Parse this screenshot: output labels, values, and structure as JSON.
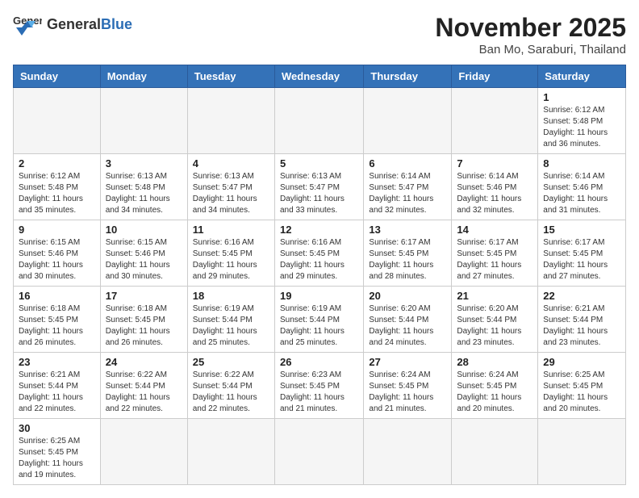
{
  "header": {
    "logo_general": "General",
    "logo_blue": "Blue",
    "month_title": "November 2025",
    "location": "Ban Mo, Saraburi, Thailand"
  },
  "weekdays": [
    "Sunday",
    "Monday",
    "Tuesday",
    "Wednesday",
    "Thursday",
    "Friday",
    "Saturday"
  ],
  "weeks": [
    [
      {
        "day": "",
        "info": ""
      },
      {
        "day": "",
        "info": ""
      },
      {
        "day": "",
        "info": ""
      },
      {
        "day": "",
        "info": ""
      },
      {
        "day": "",
        "info": ""
      },
      {
        "day": "",
        "info": ""
      },
      {
        "day": "1",
        "info": "Sunrise: 6:12 AM\nSunset: 5:48 PM\nDaylight: 11 hours\nand 36 minutes."
      }
    ],
    [
      {
        "day": "2",
        "info": "Sunrise: 6:12 AM\nSunset: 5:48 PM\nDaylight: 11 hours\nand 35 minutes."
      },
      {
        "day": "3",
        "info": "Sunrise: 6:13 AM\nSunset: 5:48 PM\nDaylight: 11 hours\nand 34 minutes."
      },
      {
        "day": "4",
        "info": "Sunrise: 6:13 AM\nSunset: 5:47 PM\nDaylight: 11 hours\nand 34 minutes."
      },
      {
        "day": "5",
        "info": "Sunrise: 6:13 AM\nSunset: 5:47 PM\nDaylight: 11 hours\nand 33 minutes."
      },
      {
        "day": "6",
        "info": "Sunrise: 6:14 AM\nSunset: 5:47 PM\nDaylight: 11 hours\nand 32 minutes."
      },
      {
        "day": "7",
        "info": "Sunrise: 6:14 AM\nSunset: 5:46 PM\nDaylight: 11 hours\nand 32 minutes."
      },
      {
        "day": "8",
        "info": "Sunrise: 6:14 AM\nSunset: 5:46 PM\nDaylight: 11 hours\nand 31 minutes."
      }
    ],
    [
      {
        "day": "9",
        "info": "Sunrise: 6:15 AM\nSunset: 5:46 PM\nDaylight: 11 hours\nand 30 minutes."
      },
      {
        "day": "10",
        "info": "Sunrise: 6:15 AM\nSunset: 5:46 PM\nDaylight: 11 hours\nand 30 minutes."
      },
      {
        "day": "11",
        "info": "Sunrise: 6:16 AM\nSunset: 5:45 PM\nDaylight: 11 hours\nand 29 minutes."
      },
      {
        "day": "12",
        "info": "Sunrise: 6:16 AM\nSunset: 5:45 PM\nDaylight: 11 hours\nand 29 minutes."
      },
      {
        "day": "13",
        "info": "Sunrise: 6:17 AM\nSunset: 5:45 PM\nDaylight: 11 hours\nand 28 minutes."
      },
      {
        "day": "14",
        "info": "Sunrise: 6:17 AM\nSunset: 5:45 PM\nDaylight: 11 hours\nand 27 minutes."
      },
      {
        "day": "15",
        "info": "Sunrise: 6:17 AM\nSunset: 5:45 PM\nDaylight: 11 hours\nand 27 minutes."
      }
    ],
    [
      {
        "day": "16",
        "info": "Sunrise: 6:18 AM\nSunset: 5:45 PM\nDaylight: 11 hours\nand 26 minutes."
      },
      {
        "day": "17",
        "info": "Sunrise: 6:18 AM\nSunset: 5:45 PM\nDaylight: 11 hours\nand 26 minutes."
      },
      {
        "day": "18",
        "info": "Sunrise: 6:19 AM\nSunset: 5:44 PM\nDaylight: 11 hours\nand 25 minutes."
      },
      {
        "day": "19",
        "info": "Sunrise: 6:19 AM\nSunset: 5:44 PM\nDaylight: 11 hours\nand 25 minutes."
      },
      {
        "day": "20",
        "info": "Sunrise: 6:20 AM\nSunset: 5:44 PM\nDaylight: 11 hours\nand 24 minutes."
      },
      {
        "day": "21",
        "info": "Sunrise: 6:20 AM\nSunset: 5:44 PM\nDaylight: 11 hours\nand 23 minutes."
      },
      {
        "day": "22",
        "info": "Sunrise: 6:21 AM\nSunset: 5:44 PM\nDaylight: 11 hours\nand 23 minutes."
      }
    ],
    [
      {
        "day": "23",
        "info": "Sunrise: 6:21 AM\nSunset: 5:44 PM\nDaylight: 11 hours\nand 22 minutes."
      },
      {
        "day": "24",
        "info": "Sunrise: 6:22 AM\nSunset: 5:44 PM\nDaylight: 11 hours\nand 22 minutes."
      },
      {
        "day": "25",
        "info": "Sunrise: 6:22 AM\nSunset: 5:44 PM\nDaylight: 11 hours\nand 22 minutes."
      },
      {
        "day": "26",
        "info": "Sunrise: 6:23 AM\nSunset: 5:45 PM\nDaylight: 11 hours\nand 21 minutes."
      },
      {
        "day": "27",
        "info": "Sunrise: 6:24 AM\nSunset: 5:45 PM\nDaylight: 11 hours\nand 21 minutes."
      },
      {
        "day": "28",
        "info": "Sunrise: 6:24 AM\nSunset: 5:45 PM\nDaylight: 11 hours\nand 20 minutes."
      },
      {
        "day": "29",
        "info": "Sunrise: 6:25 AM\nSunset: 5:45 PM\nDaylight: 11 hours\nand 20 minutes."
      }
    ],
    [
      {
        "day": "30",
        "info": "Sunrise: 6:25 AM\nSunset: 5:45 PM\nDaylight: 11 hours\nand 19 minutes."
      },
      {
        "day": "",
        "info": ""
      },
      {
        "day": "",
        "info": ""
      },
      {
        "day": "",
        "info": ""
      },
      {
        "day": "",
        "info": ""
      },
      {
        "day": "",
        "info": ""
      },
      {
        "day": "",
        "info": ""
      }
    ]
  ]
}
